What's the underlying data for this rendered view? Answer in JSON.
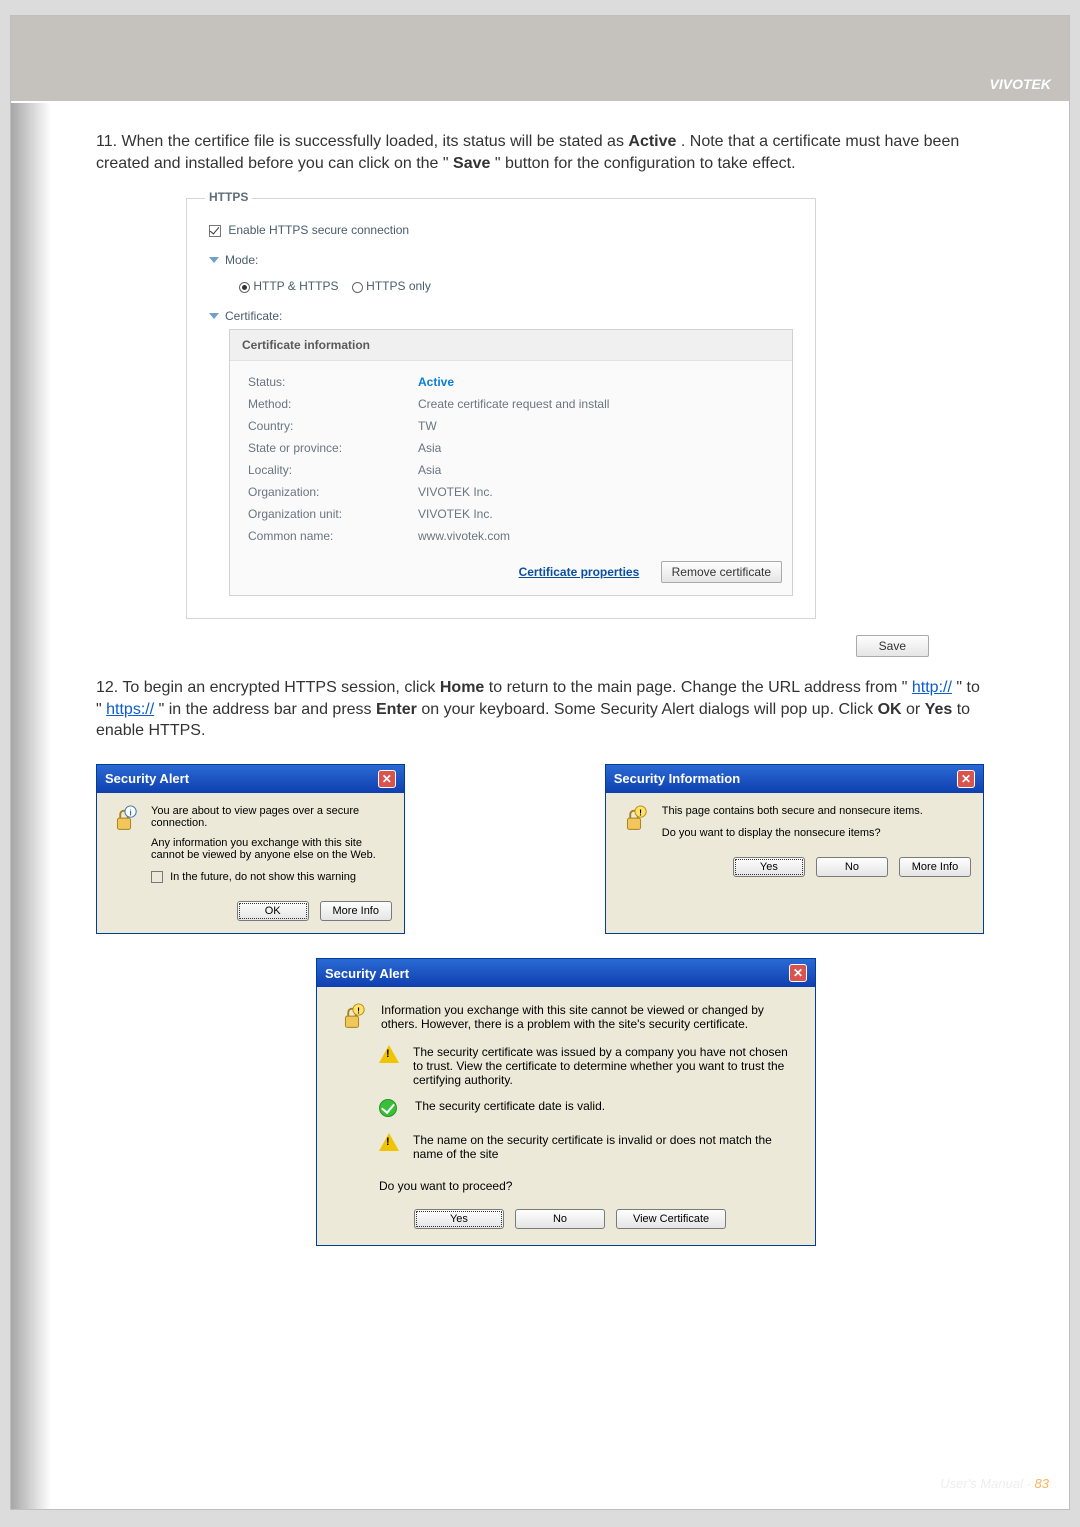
{
  "header": {
    "brand": "VIVOTEK"
  },
  "footer": {
    "label": "User's Manual - ",
    "page": "83"
  },
  "para1": {
    "prefix": "11.  When the certifice file is successfully loaded, its status will be stated as ",
    "active_word": "Active",
    "mid": ". Note that a certificate must have been created and installed before you can click on the \"",
    "save_word": "Save",
    "suffix": "\" button for the configuration to take effect."
  },
  "https": {
    "legend": "HTTPS",
    "enable_label": "Enable HTTPS secure connection",
    "mode_label": "Mode:",
    "mode_http_https": "HTTP & HTTPS",
    "mode_https_only": "HTTPS only",
    "cert_label": "Certificate:",
    "cert_head": "Certificate information",
    "rows": {
      "status_label": "Status:",
      "status_value": "Active",
      "method_label": "Method:",
      "method_value": "Create certificate request and install",
      "country_label": "Country:",
      "country_value": "TW",
      "state_label": "State or province:",
      "state_value": "Asia",
      "locality_label": "Locality:",
      "locality_value": "Asia",
      "org_label": "Organization:",
      "org_value": "VIVOTEK Inc.",
      "orgunit_label": "Organization unit:",
      "orgunit_value": "VIVOTEK Inc.",
      "cn_label": "Common name:",
      "cn_value": "www.vivotek.com"
    },
    "cert_props_link": "Certificate properties",
    "remove_btn": "Remove certificate",
    "save_btn": "Save"
  },
  "para2": {
    "prefix": "12. To begin an encrypted HTTPS session, click ",
    "home": "Home",
    "t1": " to return to the main page. Change the URL address from \"",
    "http": "http://",
    "t2": "\" to \"",
    "https": "https://",
    "t3": "\" in the address bar and press ",
    "enter": "Enter",
    "t4": " on your keyboard. Some Security Alert dialogs will pop up. Click ",
    "ok": "OK",
    "t5": " or ",
    "yes": "Yes",
    "t6": " to enable HTTPS."
  },
  "dlg1": {
    "title": "Security Alert",
    "line1": "You are about to view pages over a secure connection.",
    "line2": "Any information you exchange with this site cannot be viewed by anyone else on the Web.",
    "cb_label": "In the future, do not show this warning",
    "ok": "OK",
    "more": "More Info"
  },
  "dlg2": {
    "title": "Security Information",
    "line1": "This page contains both secure and nonsecure items.",
    "line2": "Do you want to display the nonsecure items?",
    "yes": "Yes",
    "no": "No",
    "more": "More Info"
  },
  "dlg3": {
    "title": "Security Alert",
    "intro": "Information you exchange with this site cannot be viewed or changed by others. However, there is a problem with the site's security certificate.",
    "i1": "The security certificate was issued by a company you have not chosen to trust. View the certificate to determine whether you want to trust the certifying authority.",
    "i2": "The security certificate date is valid.",
    "i3": "The name on the security certificate is invalid or does not match the name of the site",
    "q": "Do you want to proceed?",
    "yes": "Yes",
    "no": "No",
    "view": "View Certificate"
  }
}
